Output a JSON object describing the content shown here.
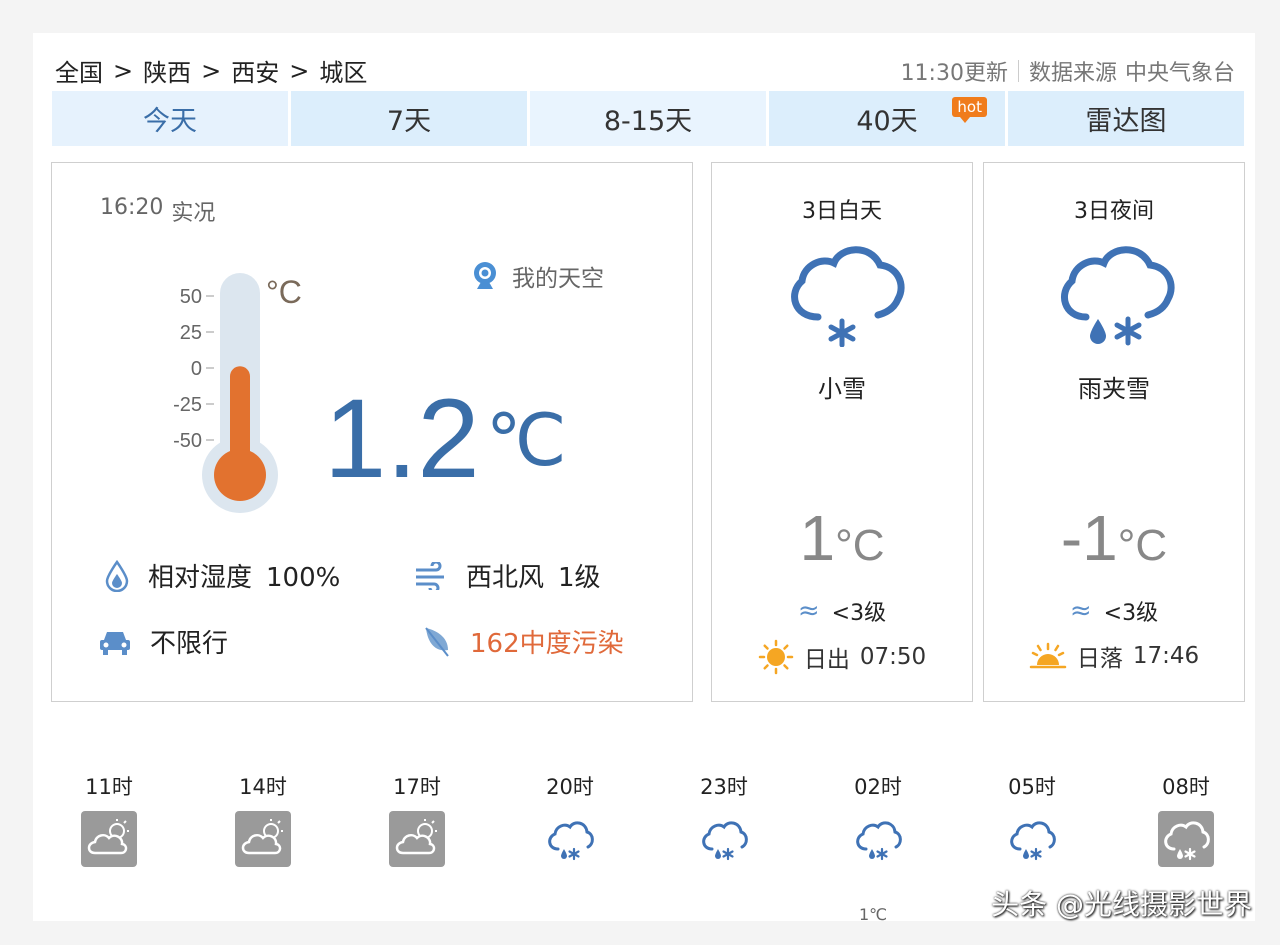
{
  "breadcrumb": [
    "全国",
    "陕西",
    "西安",
    "城区"
  ],
  "breadcrumb_separator": ">",
  "header": {
    "update_time": "11:30更新",
    "source_label": "数据来源",
    "source_name": "中央气象台"
  },
  "tabs": [
    {
      "label": "今天",
      "active": true
    },
    {
      "label": "7天"
    },
    {
      "label": "8-15天"
    },
    {
      "label": "40天",
      "badge": "hot"
    },
    {
      "label": "雷达图"
    }
  ],
  "current": {
    "obs_time": "16:20",
    "obs_label": "实况",
    "temperature": "1.2",
    "unit": "℃",
    "thermometer": {
      "scale_unit": "°C",
      "ticks": [
        "50",
        "25",
        "0",
        "-25",
        "-50"
      ],
      "range_min": -50,
      "range_max": 50,
      "fill_value": 1.2
    },
    "my_sky": "我的天空",
    "humidity_label": "相对湿度",
    "humidity_value": "100%",
    "wind_label": "西北风",
    "wind_value": "1级",
    "traffic": "不限行",
    "aqi_value": "162",
    "aqi_label": "中度污染"
  },
  "forecast": [
    {
      "title": "3日白天",
      "icon": "light-snow-icon",
      "weather": "小雪",
      "temp": "1",
      "unit": "°C",
      "wind": "<3级",
      "sun_label": "日出",
      "sun_time": "07:50",
      "sun_icon": "sunrise-icon"
    },
    {
      "title": "3日夜间",
      "icon": "sleet-icon",
      "weather": "雨夹雪",
      "temp": "-1",
      "unit": "°C",
      "wind": "<3级",
      "sun_label": "日落",
      "sun_time": "17:46",
      "sun_icon": "sunset-icon"
    }
  ],
  "hourly": [
    {
      "time": "11时",
      "icon": "partly-cloudy-icon"
    },
    {
      "time": "14时",
      "icon": "partly-cloudy-icon"
    },
    {
      "time": "17时",
      "icon": "partly-cloudy-icon"
    },
    {
      "time": "20时",
      "icon": "sleet-icon"
    },
    {
      "time": "23时",
      "icon": "sleet-icon"
    },
    {
      "time": "02时",
      "icon": "sleet-icon"
    },
    {
      "time": "05时",
      "icon": "sleet-icon"
    },
    {
      "time": "08时",
      "icon": "sleet-icon-gray"
    }
  ],
  "hourly_partial_temp": "1℃",
  "watermark": "头条 @光线摄影世界",
  "colors": {
    "tab_bg": "#dceefc",
    "active_tab_text": "#3a6ea8",
    "temp_blue": "#3a6ea8",
    "thermo_fill": "#e2722f",
    "icon_blue": "#3f72b5",
    "aqi_red": "#e0693a",
    "sun_orange": "#f5a623"
  }
}
